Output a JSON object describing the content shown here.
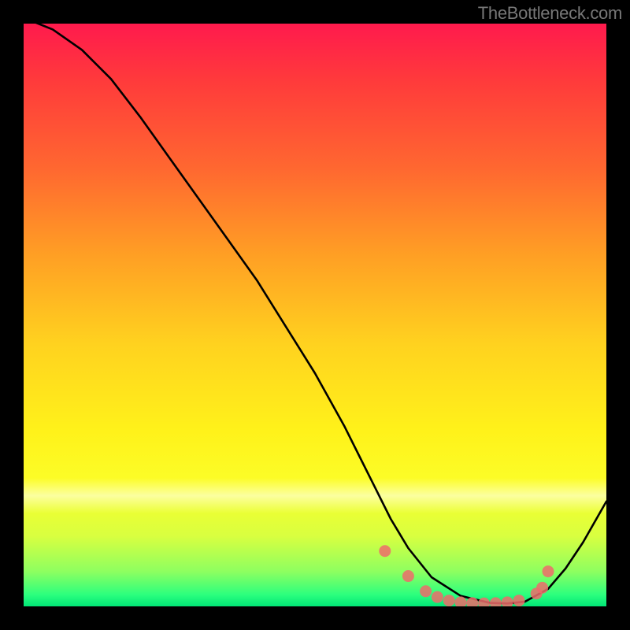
{
  "watermark": "TheBottleneck.com",
  "chart_data": {
    "type": "line",
    "title": "",
    "xlabel": "",
    "ylabel": "",
    "xlim": [
      0,
      100
    ],
    "ylim": [
      0,
      100
    ],
    "series": [
      {
        "name": "bottleneck-curve",
        "x": [
          0,
          5,
          10,
          15,
          20,
          25,
          30,
          35,
          40,
          45,
          50,
          55,
          58,
          60,
          63,
          66,
          70,
          75,
          80,
          83,
          86,
          90,
          93,
          96,
          100
        ],
        "y": [
          101,
          99,
          95.5,
          90.5,
          84,
          77,
          70,
          63,
          56,
          48,
          40,
          31,
          25,
          21,
          15,
          10,
          5,
          1.8,
          0.6,
          0.5,
          0.8,
          3,
          6.5,
          11,
          18
        ]
      }
    ],
    "markers": {
      "name": "highlight-range",
      "color": "#ef6b6b",
      "points": [
        {
          "x": 62,
          "y": 9.5
        },
        {
          "x": 66,
          "y": 5.2
        },
        {
          "x": 69,
          "y": 2.6
        },
        {
          "x": 71,
          "y": 1.6
        },
        {
          "x": 73,
          "y": 1.0
        },
        {
          "x": 75,
          "y": 0.7
        },
        {
          "x": 77,
          "y": 0.55
        },
        {
          "x": 79,
          "y": 0.5
        },
        {
          "x": 81,
          "y": 0.55
        },
        {
          "x": 83,
          "y": 0.7
        },
        {
          "x": 85,
          "y": 1.0
        },
        {
          "x": 88,
          "y": 2.2
        },
        {
          "x": 89,
          "y": 3.2
        },
        {
          "x": 90,
          "y": 6.0
        }
      ]
    },
    "background_gradient": {
      "top": "#ff1a4d",
      "mid": "#fff21a",
      "bottom": "#00e676"
    }
  }
}
